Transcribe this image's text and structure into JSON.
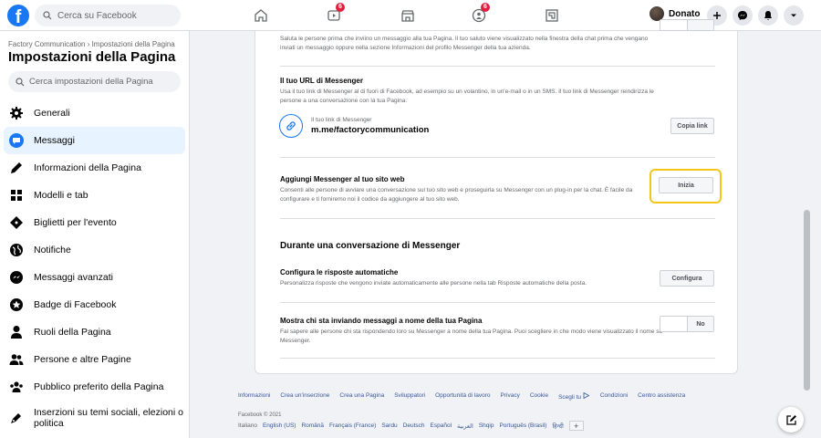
{
  "topbar": {
    "search_placeholder": "Cerca su Facebook",
    "user_name": "Donato",
    "badges": {
      "watch": "6",
      "groups": "6"
    }
  },
  "sidebar": {
    "breadcrumb": "Factory Communication › Impostazioni della Pagina",
    "title": "Impostazioni della Pagina",
    "search_placeholder": "Cerca impostazioni della Pagina",
    "items": [
      {
        "label": "Generali",
        "icon": "gear-icon"
      },
      {
        "label": "Messaggi",
        "icon": "chat-icon"
      },
      {
        "label": "Informazioni della Pagina",
        "icon": "pencil-icon"
      },
      {
        "label": "Modelli e tab",
        "icon": "grid-icon"
      },
      {
        "label": "Biglietti per l'evento",
        "icon": "ticket-icon"
      },
      {
        "label": "Notifiche",
        "icon": "globe-icon"
      },
      {
        "label": "Messaggi avanzati",
        "icon": "messenger-icon"
      },
      {
        "label": "Badge di Facebook",
        "icon": "star-badge-icon"
      },
      {
        "label": "Ruoli della Pagina",
        "icon": "person-icon"
      },
      {
        "label": "Persone e altre Pagine",
        "icon": "people-icon"
      },
      {
        "label": "Pubblico preferito della Pagina",
        "icon": "audience-icon"
      },
      {
        "label": "Inserzioni su temi sociali, elezioni o politica",
        "icon": "pen-icon"
      }
    ]
  },
  "main": {
    "top_desc": "Saluta le persone prima che inviino un messaggio alla tua Pagina. Il tuo saluto viene visualizzato nella finestra della chat prima che vengano inviati un messaggio oppure nella sezione Informazioni del profilo Messenger della tua azienda.",
    "url_section": {
      "title": "Il tuo URL di Messenger",
      "desc": "Usa il tuo link di Messenger al di fuori di Facebook, ad esempio su un volantino, in un'e-mail o in un SMS. Il tuo link di Messenger reindirizza le persone a una conversazione con la tua Pagina.",
      "link_label": "Il tuo link di Messenger",
      "link_value": "m.me/factorycommunication",
      "copy_button": "Copia link"
    },
    "website_section": {
      "title": "Aggiungi Messenger al tuo sito web",
      "desc": "Consenti alle persone di avviare una conversazione sul tuo sito web e proseguirla su Messenger con un plug-in per la chat. È facile da configurare e ti forniremo noi il codice da aggiungere al tuo sito web.",
      "button": "Inizia"
    },
    "conversation_heading": "Durante una conversazione di Messenger",
    "auto_reply": {
      "title": "Configura le risposte automatiche",
      "desc": "Personalizza risposte che vengono inviate automaticamente alle persone nella tab Risposte automatiche della posta.",
      "button": "Configura"
    },
    "show_sender": {
      "title": "Mostra chi sta inviando messaggi a nome della tua Pagina",
      "desc": "Fai sapere alle persone chi sta rispondendo loro su Messenger a nome della tua Pagina. Puoi scegliere in che modo viene visualizzato il nome su Messenger.",
      "toggle": "No"
    }
  },
  "footer": {
    "links": [
      "Informazioni",
      "Crea un'inserzione",
      "Crea una Pagina",
      "Sviluppatori",
      "Opportunità di lavoro",
      "Privacy",
      "Cookie",
      "Scegli tu",
      "Condizioni",
      "Centro assistenza"
    ],
    "copyright": "Facebook © 2021",
    "current_lang": "Italiano",
    "languages": [
      "English (US)",
      "Română",
      "Français (France)",
      "Sardu",
      "Deutsch",
      "Español",
      "العربية",
      "Shqip",
      "Português (Brasil)",
      "हिन्दी"
    ],
    "more": "+"
  }
}
